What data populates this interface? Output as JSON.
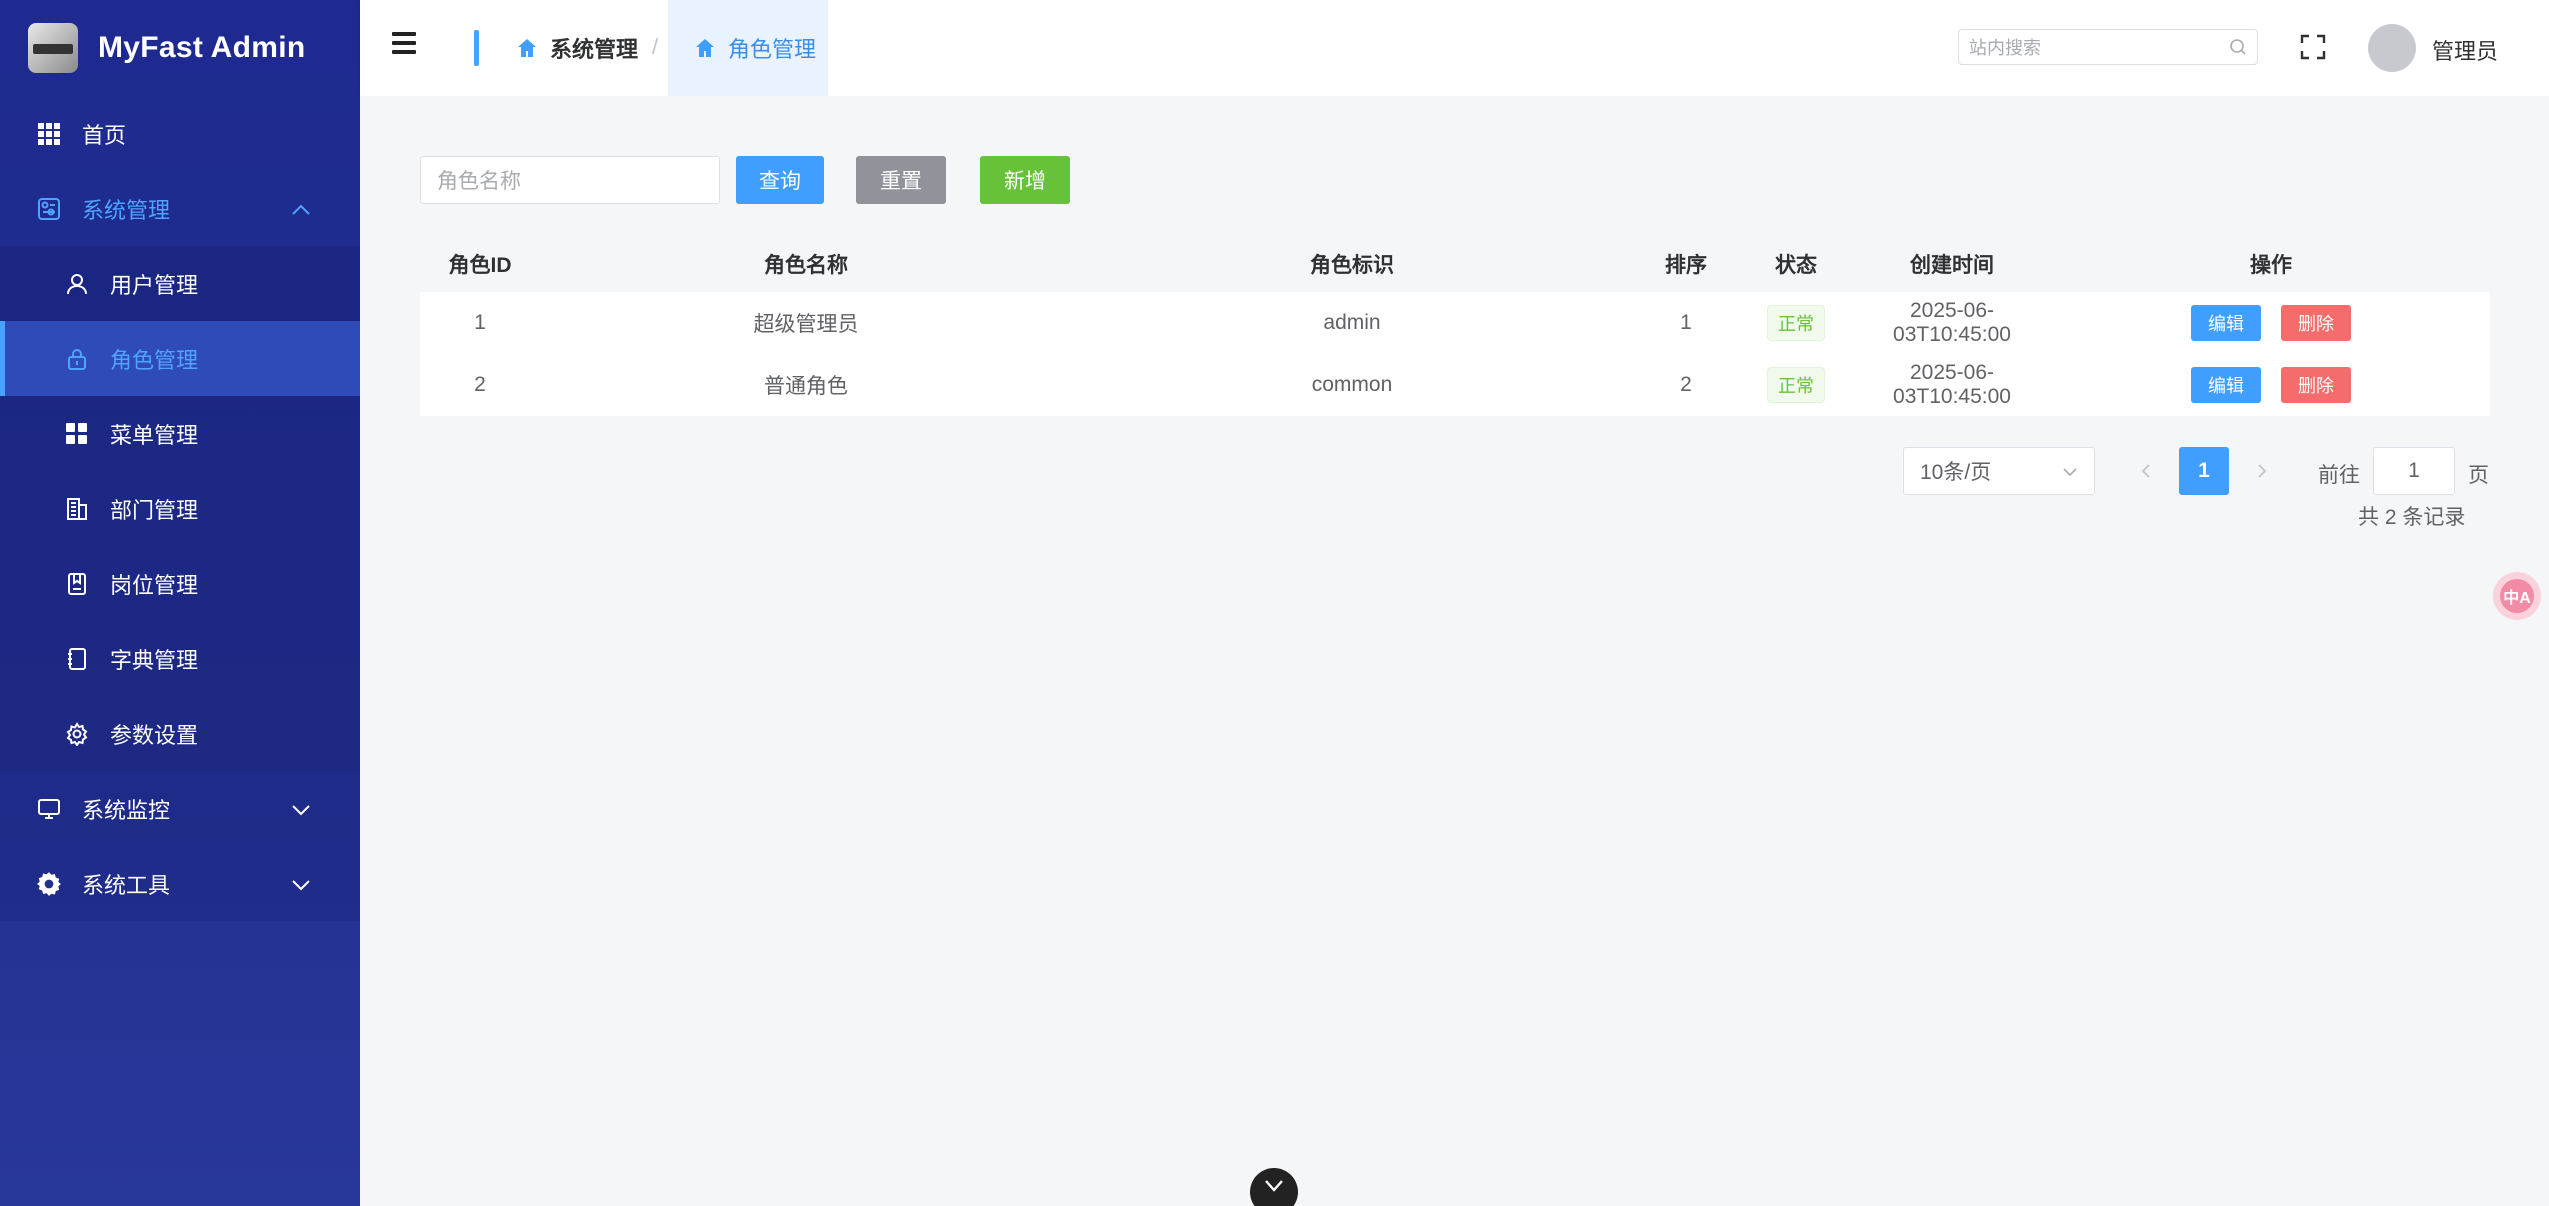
{
  "app": {
    "title": "MyFast Admin"
  },
  "sidebar": {
    "home": "首页",
    "system": "系统管理",
    "sub_items": [
      {
        "label": "用户管理",
        "icon": "user-icon"
      },
      {
        "label": "角色管理",
        "icon": "lock-icon"
      },
      {
        "label": "菜单管理",
        "icon": "grid-icon"
      },
      {
        "label": "部门管理",
        "icon": "building-icon"
      },
      {
        "label": "岗位管理",
        "icon": "badge-icon"
      },
      {
        "label": "字典管理",
        "icon": "notebook-icon"
      },
      {
        "label": "参数设置",
        "icon": "gear-icon"
      }
    ],
    "monitor": "系统监控",
    "tools": "系统工具"
  },
  "header": {
    "breadcrumb": [
      "系统管理",
      "角色管理"
    ],
    "separator": "/",
    "search_placeholder": "站内搜索",
    "user_name": "管理员"
  },
  "toolbar": {
    "role_name_placeholder": "角色名称",
    "query": "查询",
    "reset": "重置",
    "add": "新增"
  },
  "table": {
    "columns": [
      "角色ID",
      "角色名称",
      "角色标识",
      "排序",
      "状态",
      "创建时间",
      "操作"
    ],
    "rows": [
      {
        "id": "1",
        "name": "超级管理员",
        "key": "admin",
        "sort": "1",
        "status": "正常",
        "created": "2025-06-03T10:45:00",
        "edit": "编辑",
        "delete": "删除"
      },
      {
        "id": "2",
        "name": "普通角色",
        "key": "common",
        "sort": "2",
        "status": "正常",
        "created": "2025-06-03T10:45:00",
        "edit": "编辑",
        "delete": "删除"
      }
    ]
  },
  "pagination": {
    "page_size": "10条/页",
    "current_page": "1",
    "goto_label": "前往",
    "goto_value": "1",
    "goto_suffix": "页",
    "total": "共 2 条记录"
  },
  "floating": {
    "translate_label": "中A"
  },
  "colors": {
    "primary": "#409eff",
    "success": "#67c23a",
    "danger": "#f56c6c",
    "info": "#909399",
    "sidebar": "#1e2a8f"
  }
}
